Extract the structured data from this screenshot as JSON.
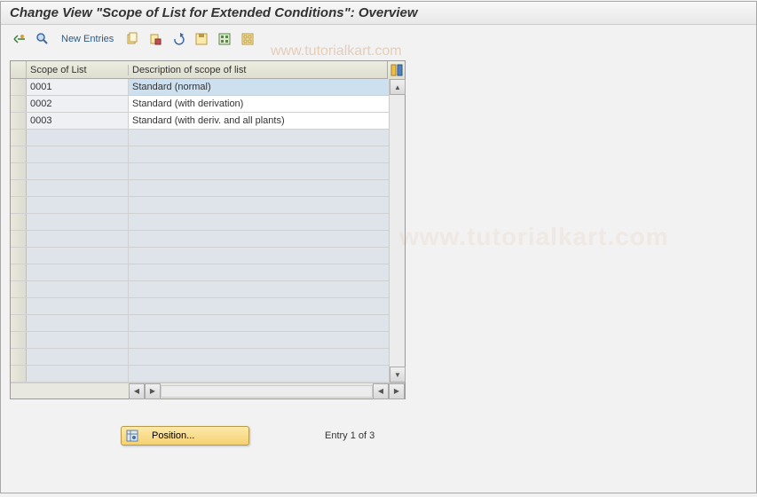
{
  "header": {
    "title": "Change View \"Scope of List for Extended Conditions\": Overview"
  },
  "toolbar": {
    "new_entries_label": "New Entries"
  },
  "watermark": "www.tutorialkart.com",
  "table": {
    "headers": {
      "scope": "Scope of List",
      "desc": "Description of scope of list"
    },
    "rows": [
      {
        "scope": "0001",
        "desc": "Standard (normal)",
        "selected": true
      },
      {
        "scope": "0002",
        "desc": "Standard (with derivation)",
        "selected": false
      },
      {
        "scope": "0003",
        "desc": "Standard (with deriv. and all plants)",
        "selected": false
      }
    ]
  },
  "footer": {
    "position_label": "Position...",
    "entry_label": "Entry 1 of 3"
  }
}
